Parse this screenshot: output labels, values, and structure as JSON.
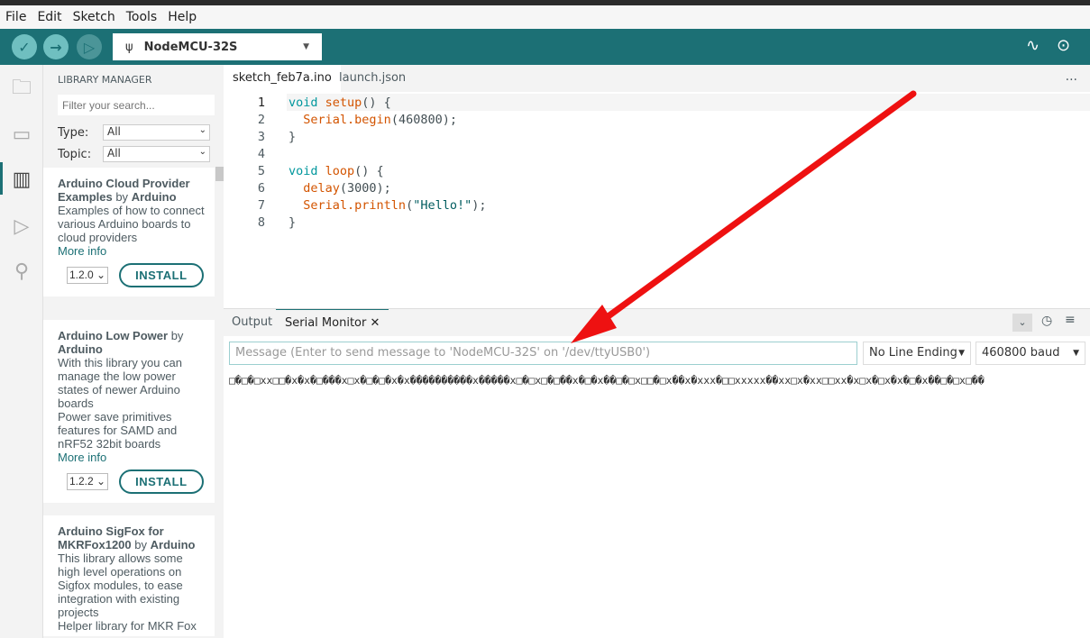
{
  "menu": [
    "File",
    "Edit",
    "Sketch",
    "Tools",
    "Help"
  ],
  "toolbar": {
    "board": "NodeMCU-32S"
  },
  "sidebar": {
    "title": "LIBRARY MANAGER",
    "search_placeholder": "Filter your search...",
    "type_label": "Type:",
    "type_value": "All",
    "topic_label": "Topic:",
    "topic_value": "All",
    "libraries": [
      {
        "name": "Arduino Cloud Provider Examples",
        "by": "by",
        "author": "Arduino",
        "desc": "Examples of how to connect various Arduino boards to cloud providers",
        "more": "More info",
        "version": "1.2.0",
        "install": "INSTALL"
      },
      {
        "name": "Arduino Low Power",
        "by": "by",
        "author": "Arduino",
        "desc": "With this library you can manage the low power states of newer Arduino boards",
        "desc2": "Power save primitives features for SAMD and nRF52 32bit boards",
        "more": "More info",
        "version": "1.2.2",
        "install": "INSTALL"
      },
      {
        "name": "Arduino SigFox for MKRFox1200",
        "by": "by",
        "author": "Arduino",
        "desc": "This library allows some high level operations on Sigfox modules, to ease integration with existing projects",
        "desc2": "Helper library for MKR Fox"
      }
    ]
  },
  "tabs": [
    "sketch_feb7a.ino",
    "launch.json"
  ],
  "more_icon": "...",
  "code": {
    "line_numbers": [
      "1",
      "2",
      "3",
      "4",
      "5",
      "6",
      "7",
      "8"
    ],
    "l1": {
      "kw": "void",
      "fn": "setup",
      "rest": "() {"
    },
    "l2": {
      "fn": "Serial.begin",
      "rest": "(460800);"
    },
    "l3": "}",
    "l5": {
      "kw": "void",
      "fn": "loop",
      "rest": "() {"
    },
    "l6": {
      "fn": "delay",
      "rest": "(3000);"
    },
    "l7": {
      "fn": "Serial.println",
      "str": "\"Hello!\"",
      "rest": ");",
      "open": "("
    },
    "l8": "}"
  },
  "panel": {
    "tabs": [
      "Output",
      "Serial Monitor"
    ],
    "message_placeholder": "Message (Enter to send message to 'NodeMCU-32S' on '/dev/ttyUSB0')",
    "line_ending": "No Line Ending",
    "baud": "460800 baud",
    "output": "□�□�□xx□□�x�x�□���x□x�□�□�x�x����������x�����x□�□x□�□��x�□�x��□�□x□□�□x��x�xxx�□□xxxxx��xx□x�xx□□xx�x□x�□x�x�□�x��□�□x□��"
  },
  "colors": {
    "teal": "#1c7075",
    "arrow": "#ee1111"
  }
}
